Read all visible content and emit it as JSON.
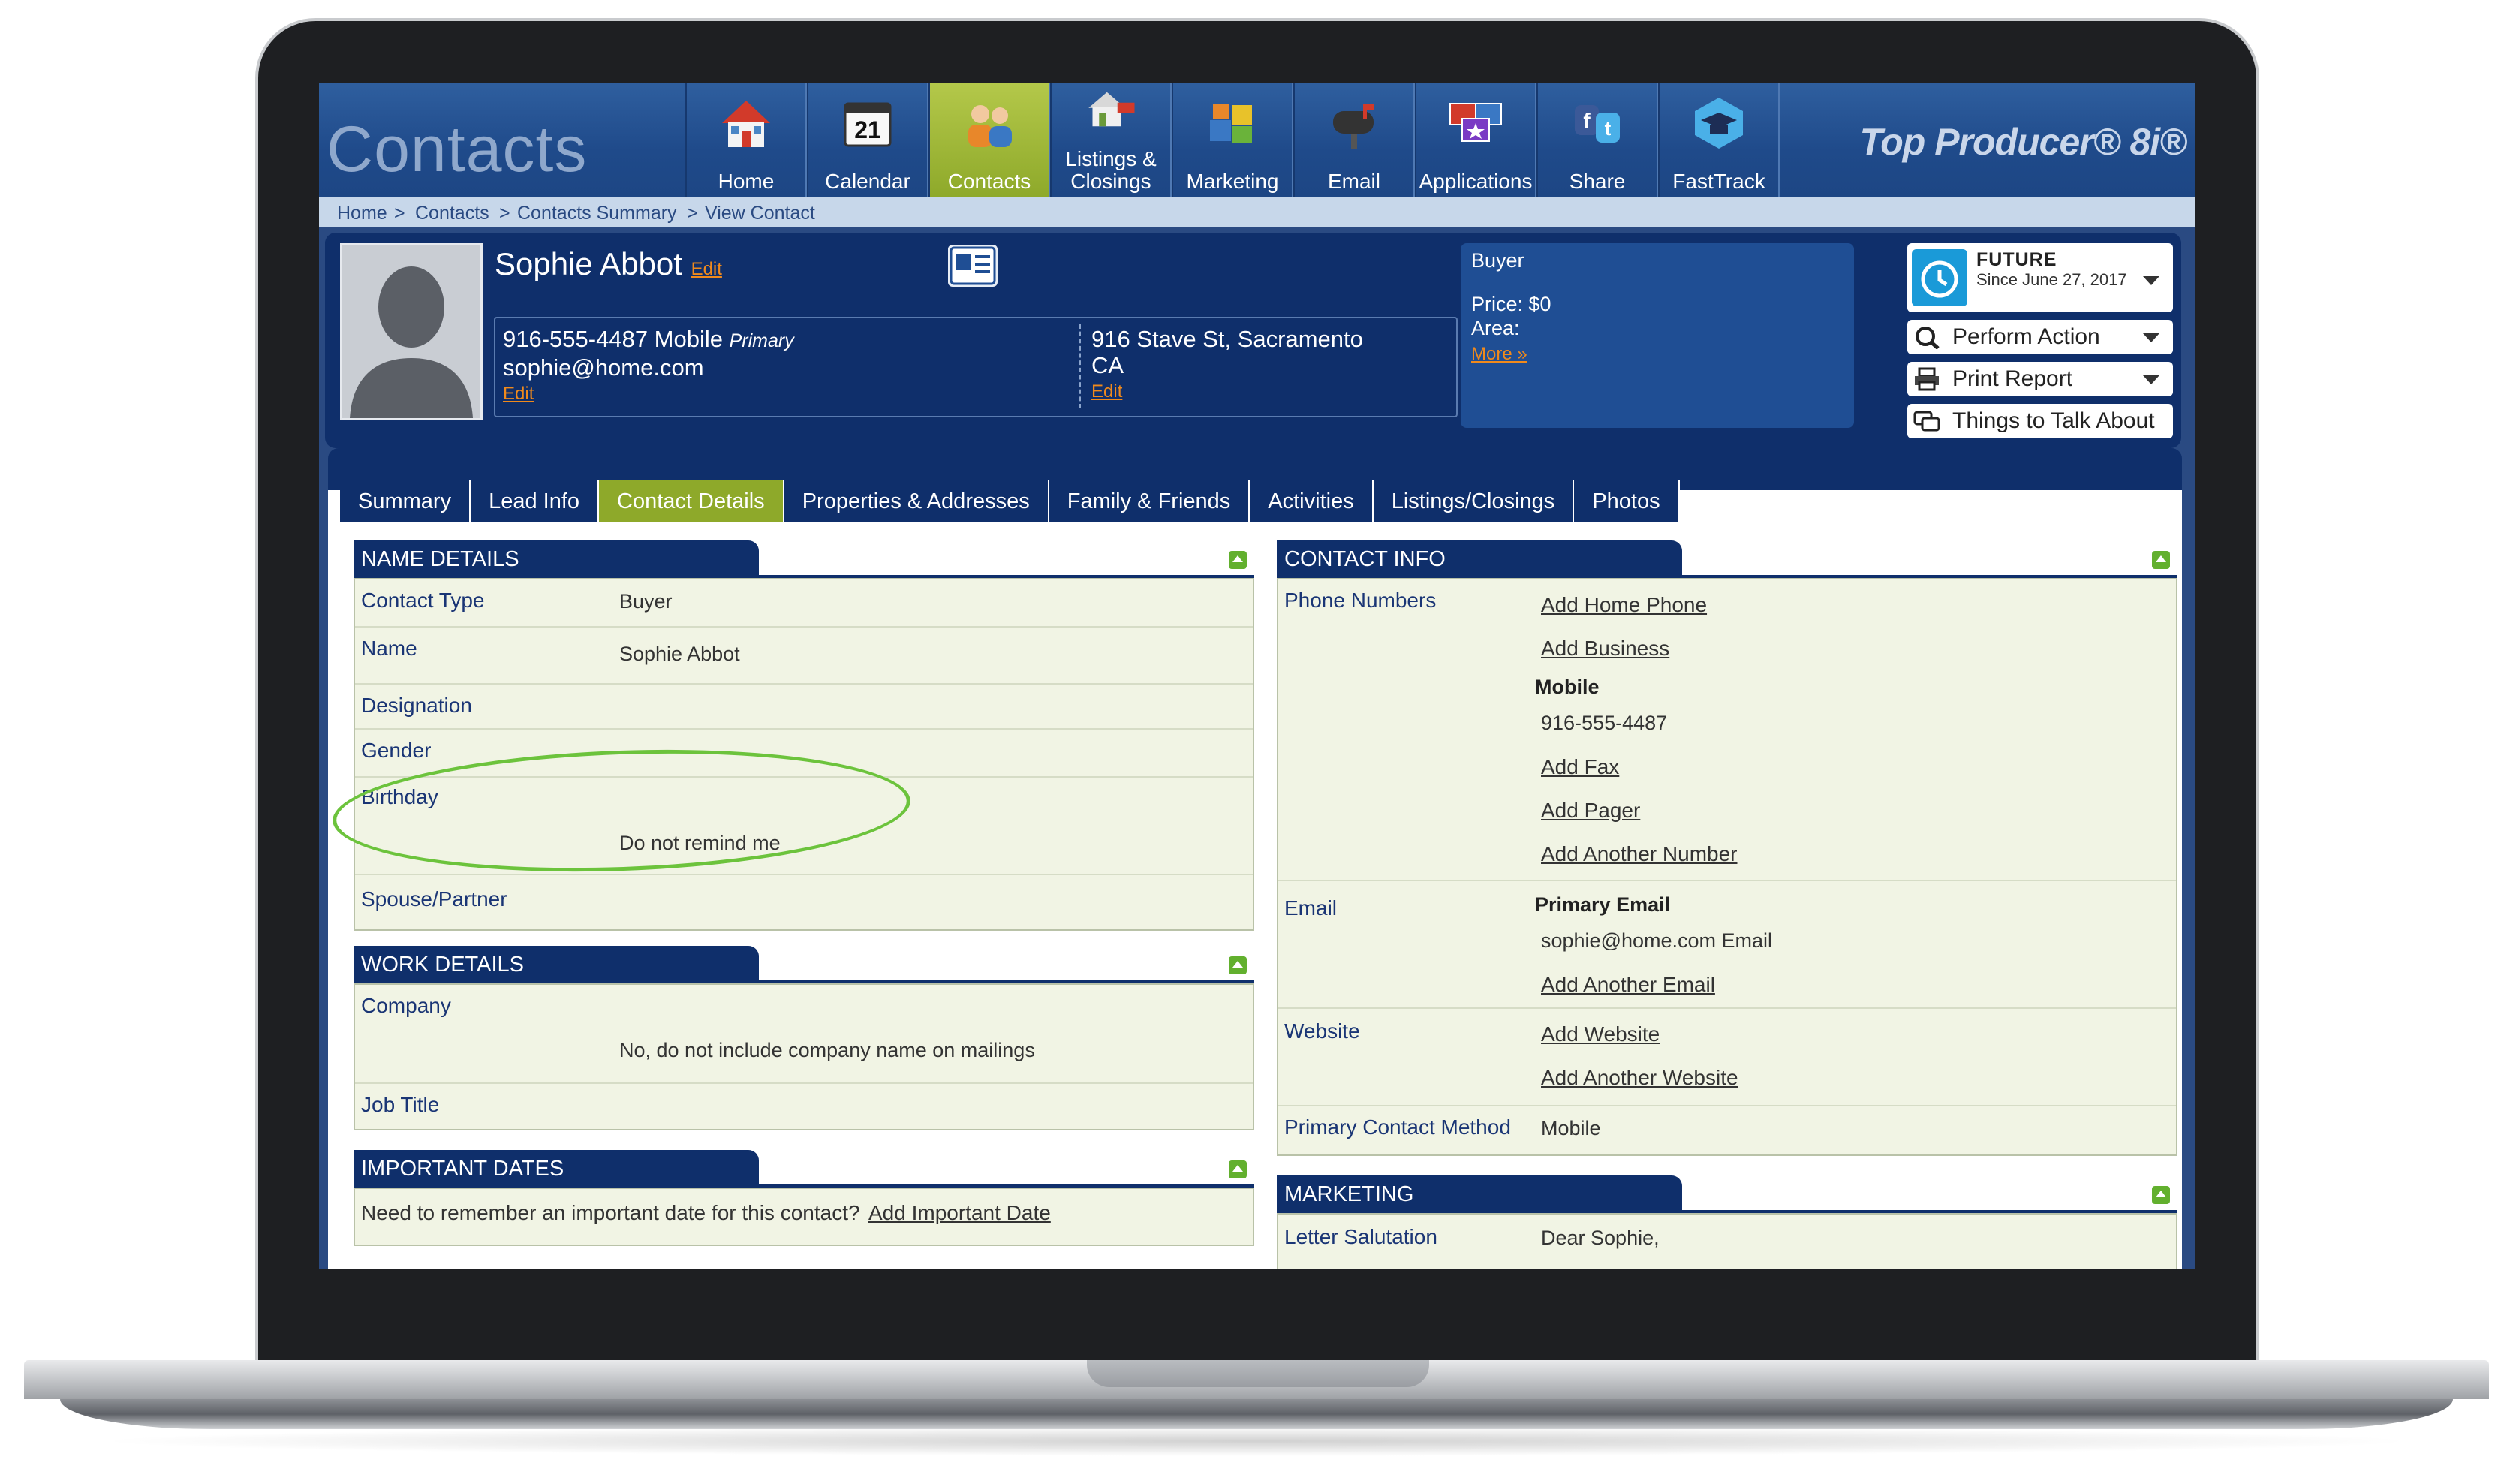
{
  "app": {
    "title": "Contacts",
    "brand": "Top Producer® 8i®"
  },
  "nav": [
    {
      "label": "Home",
      "icon": "house-icon"
    },
    {
      "label": "Calendar",
      "icon": "calendar-icon",
      "badge": "21"
    },
    {
      "label": "Contacts",
      "icon": "contacts-icon"
    },
    {
      "label": "Listings &",
      "label2": "Closings",
      "icon": "listings-icon"
    },
    {
      "label": "Marketing",
      "icon": "marketing-icon"
    },
    {
      "label": "Email",
      "icon": "mailbox-icon"
    },
    {
      "label": "Applications",
      "icon": "applications-icon"
    },
    {
      "label": "Share",
      "icon": "share-icon"
    },
    {
      "label": "FastTrack",
      "icon": "graduation-cap-icon"
    }
  ],
  "breadcrumb": [
    "Home",
    "Contacts",
    "Contacts Summary",
    "View Contact"
  ],
  "contact": {
    "name": "Sophie Abbot",
    "edit": "Edit",
    "phone": "916-555-4487 Mobile",
    "phone_tag": "Primary",
    "email": "sophie@home.com",
    "address1": "916 Stave St, Sacramento",
    "address2": "CA"
  },
  "buyer": {
    "type": "Buyer",
    "price": "Price: $0",
    "area": "Area:",
    "more": "More »"
  },
  "status": {
    "title": "FUTURE",
    "since": "Since June 27, 2017"
  },
  "actions": [
    "Perform Action",
    "Print Report",
    "Things to Talk About"
  ],
  "tabs": [
    "Summary",
    "Lead Info",
    "Contact Details",
    "Properties & Addresses",
    "Family & Friends",
    "Activities",
    "Listings/Closings",
    "Photos"
  ],
  "active_tab": "Contact Details",
  "name_details": {
    "title": "NAME DETAILS",
    "contact_type_label": "Contact Type",
    "contact_type": "Buyer",
    "name_label": "Name",
    "name": "Sophie Abbot",
    "designation_label": "Designation",
    "gender_label": "Gender",
    "birthday_label": "Birthday",
    "birthday_remind": "Do not remind me",
    "spouse_label": "Spouse/Partner"
  },
  "work_details": {
    "title": "WORK DETAILS",
    "company_label": "Company",
    "company_mailings": "No, do not include company name on mailings",
    "job_title_label": "Job Title"
  },
  "important_dates": {
    "title": "IMPORTANT DATES",
    "prompt": "Need to remember an important date for this contact?",
    "add_link": "Add Important Date"
  },
  "contact_info": {
    "title": "CONTACT INFO",
    "phone_label": "Phone Numbers",
    "add_home": "Add Home Phone",
    "add_business": "Add Business",
    "mobile_label": "Mobile",
    "mobile": "916-555-4487",
    "add_fax": "Add Fax",
    "add_pager": "Add Pager",
    "add_number": "Add Another Number",
    "email_label": "Email",
    "primary_email_label": "Primary Email",
    "primary_email": "sophie@home.com Email",
    "add_email": "Add Another Email",
    "website_label": "Website",
    "add_website": "Add Website",
    "add_another_website": "Add Another Website",
    "method_label": "Primary Contact Method",
    "method": "Mobile"
  },
  "marketing": {
    "title": "MARKETING",
    "salutation_label": "Letter Salutation",
    "salutation": "Dear Sophie,"
  },
  "colors": {
    "accent": "#8ea92a",
    "navy": "#0f2f6b",
    "panel": "#f1f4e4",
    "highlight": "#6cc33c",
    "link": "#f08a1c"
  }
}
